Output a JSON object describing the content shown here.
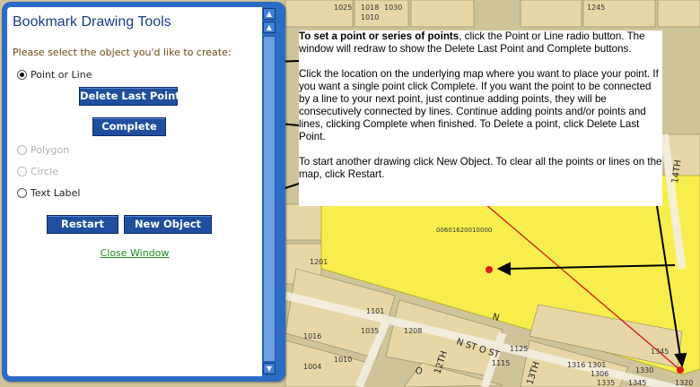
{
  "map": {
    "parcel_id": "00601620010000",
    "street_labels": [
      "N",
      "N ST O ST",
      "12TH",
      "14TH",
      "13TH",
      "O"
    ],
    "parcel_numbers": [
      "1025",
      "1018",
      "1010",
      "1030",
      "1245",
      "1201",
      "1101",
      "1035",
      "1208",
      "1125",
      "1115",
      "1016",
      "1004",
      "1010",
      "1316",
      "1301",
      "1306",
      "1330",
      "1335",
      "1345",
      "1320",
      "1345"
    ],
    "marker_color": "#e01818",
    "highlight_color": "#f7ee4e"
  },
  "panel": {
    "title": "Bookmark Drawing Tools",
    "instruction": "Please select the object you'd like to create:",
    "options": [
      {
        "label": "Point or Line",
        "selected": true,
        "enabled": true
      },
      {
        "label": "Polygon",
        "selected": false,
        "enabled": false
      },
      {
        "label": "Circle",
        "selected": false,
        "enabled": false
      },
      {
        "label": "Text Label",
        "selected": false,
        "enabled": true
      }
    ],
    "delete_last_point": "Delete Last Point",
    "complete": "Complete",
    "restart": "Restart",
    "new_object": "New Object",
    "close_window": "Close Window"
  },
  "help": {
    "p1_bold": "To set a point or series of points",
    "p1_rest": ", click the Point or Line radio button. The window will redraw to show the Delete Last Point and Complete buttons.",
    "p2": "Click the location on the underlying map where you want to place your point.  If you want a single point click Complete.  If you want the point to be connected by a line to your next point, just continue adding points, they will be consecutively connected by lines. Continue adding points and/or points and lines, clicking Complete when finished.  To Delete a point, click Delete Last Point.",
    "p3": "To start another drawing click New Object.  To clear all the points or lines on the map, click Restart."
  }
}
